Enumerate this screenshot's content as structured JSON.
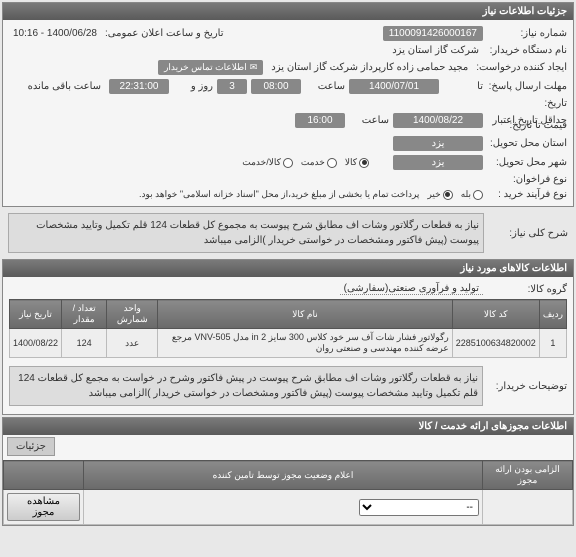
{
  "panels": {
    "needInfo": {
      "title": "جزئیات اطلاعات نیاز",
      "needNumberLabel": "شماره نیاز:",
      "needNumber": "1100091426000167",
      "publicAnnounceLabel": "تاریخ و ساعت اعلان عمومی:",
      "publicAnnounce": "1400/06/28 - 10:16",
      "buyerOrgLabel": "نام دستگاه خریدار:",
      "buyerOrg": "شرکت گاز استان یزد",
      "requesterLabel": "ایجاد کننده درخواست:",
      "requester": "مجید حمامی زاده کارپرداز شرکت گاز استان یزد",
      "contactBuyer": "اطلاعات تماس خریدار",
      "replyDeadlineLabel": "مهلت ارسال پاسخ:",
      "replyDeadlineFrom": "تا",
      "replyDate": "1400/07/01",
      "timeLabel": "ساعت",
      "replyTime": "08:00",
      "daysLabel": "روز و",
      "days": "3",
      "remainTime": "22:31:00",
      "remainLabel": "ساعت باقی مانده",
      "historyLabel": "تاریخ:",
      "validFromLabel": "حداقل تاریخ اعتبار",
      "validToLabel": "قیمت تا تاریخ:",
      "validDate": "1400/08/22",
      "validTime": "16:00",
      "deliveryProvinceLabel": "استان محل تحویل:",
      "deliveryProvince": "یزد",
      "deliveryCityLabel": "شهر محل تحویل:",
      "deliveryCity": "یزد",
      "paymentTypeLabel": "نوع فراخوان:",
      "paymentOptions": [
        "کالا",
        "خدمت",
        "کالا/خدمت"
      ],
      "paymentSelected": 0,
      "purchaseProcLabel": "نوع فرآیند خرید :",
      "purchaseNote": "پرداخت تمام یا بخشی از مبلغ خرید،از محل \"اسناد خزانه اسلامی\" خواهد بود.",
      "procOptions": [
        "بله",
        "خیر"
      ],
      "procSelected": 1
    },
    "needDesc": {
      "label": "شرح کلی نیاز:",
      "text": "نیاز به قطعات رگلاتور وشات اف مطابق شرح پیوست  به مجموع کل قطعات 124 قلم تکمیل وتایید مشخصات پیوست (پیش فاکتور ومشخصات در خواستی خریدار )الزامی میباشد"
    },
    "itemsInfo": {
      "title": "اطلاعات کالاهای مورد نیاز",
      "groupLabel": "گروه کالا:",
      "group": "تولید و فرآوری صنعتی(سفارشی)",
      "columns": [
        "ردیف",
        "کد کالا",
        "نام کالا",
        "واحد شمارش",
        "تعداد / مقدار",
        "تاریخ نیاز"
      ],
      "rows": [
        {
          "idx": "1",
          "code": "2285100634820002",
          "name": "رگولاتور فشار شات آف سر خود کلاس 300 سایز 2 in مدل VNV-505 مرجع عرضه کننده مهندسی و صنعتی روان",
          "unit": "عدد",
          "qty": "124",
          "date": "1400/08/22"
        }
      ],
      "buyerNoteLabel": "توضیحات خریدار:",
      "buyerNote": "نیاز به قطعات رگلاتور وشات اف مطابق شرح پیوست در پیش فاکتور وشرح در خواست به مجمع کل قطعات 124 قلم تکمیل وتایید مشخصات پیوست (پیش فاکتور ومشخصات در خواستی خریدار )الزامی میباشد"
    },
    "permits": {
      "title": "اطلاعات مجوزهای ارائه خدمت / کالا",
      "tab": "جزئیات",
      "viewBtn": "مشاهده مجوز",
      "mandatoryCol": "الزامی بودن ارائه مجوز",
      "statusCol": "اعلام وضعیت مجوز توسط تامین کننده",
      "ddPlaceholder": "--"
    }
  }
}
